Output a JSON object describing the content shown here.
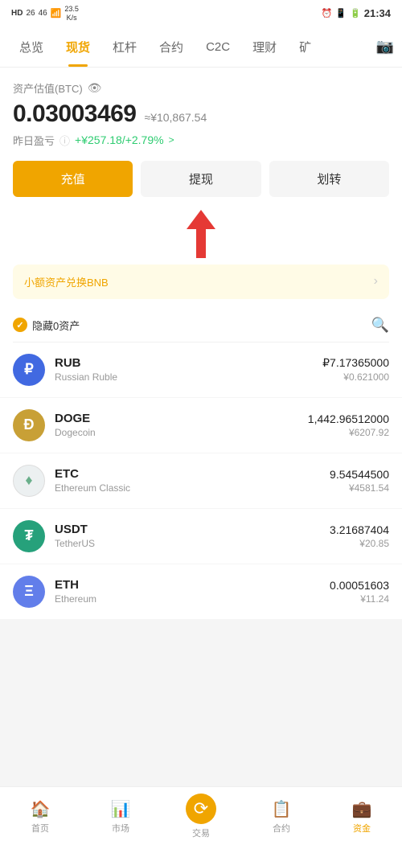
{
  "statusBar": {
    "left": "HD  26  46   23.5 K/s",
    "time": "21:34",
    "battery": "20"
  },
  "nav": {
    "items": [
      {
        "label": "总览",
        "active": false
      },
      {
        "label": "现货",
        "active": true
      },
      {
        "label": "杠杆",
        "active": false
      },
      {
        "label": "合约",
        "active": false
      },
      {
        "label": "C2C",
        "active": false
      },
      {
        "label": "理财",
        "active": false
      },
      {
        "label": "矿",
        "active": false
      }
    ]
  },
  "portfolio": {
    "assetLabel": "资产估值(BTC)",
    "balance": "0.03003469",
    "approxPrefix": "≈",
    "approxValue": "¥10,867.54",
    "pnlLabel": "昨日盈亏",
    "pnlValue": "+¥257.18/+2.79%",
    "pnlArrow": ">"
  },
  "actions": {
    "deposit": "充值",
    "withdraw": "提现",
    "transfer": "划转"
  },
  "banner": {
    "text": "小额资产兑换BNB"
  },
  "filter": {
    "label": "隐藏0资产"
  },
  "coins": [
    {
      "symbol": "RUB",
      "name": "Russian Ruble",
      "amount": "₽7.17365000",
      "cny": "¥0.621000",
      "iconType": "rub",
      "iconText": "₽"
    },
    {
      "symbol": "DOGE",
      "name": "Dogecoin",
      "amount": "1,442.96512000",
      "cny": "¥6207.92",
      "iconType": "doge",
      "iconText": "Ð"
    },
    {
      "symbol": "ETC",
      "name": "Ethereum Classic",
      "amount": "9.54544500",
      "cny": "¥4581.54",
      "iconType": "etc",
      "iconText": "♦"
    },
    {
      "symbol": "USDT",
      "name": "TetherUS",
      "amount": "3.21687404",
      "cny": "¥20.85",
      "iconType": "usdt",
      "iconText": "₮"
    },
    {
      "symbol": "ETH",
      "name": "Ethereum",
      "amount": "0.00051603",
      "cny": "¥11.24",
      "iconType": "eth",
      "iconText": "Ξ"
    }
  ],
  "bottomNav": [
    {
      "label": "首页",
      "icon": "⌂",
      "active": false
    },
    {
      "label": "市场",
      "icon": "📊",
      "active": false
    },
    {
      "label": "交易",
      "icon": "⟳",
      "active": false
    },
    {
      "label": "合约",
      "icon": "📋",
      "active": false
    },
    {
      "label": "资金",
      "icon": "💼",
      "active": true
    }
  ]
}
